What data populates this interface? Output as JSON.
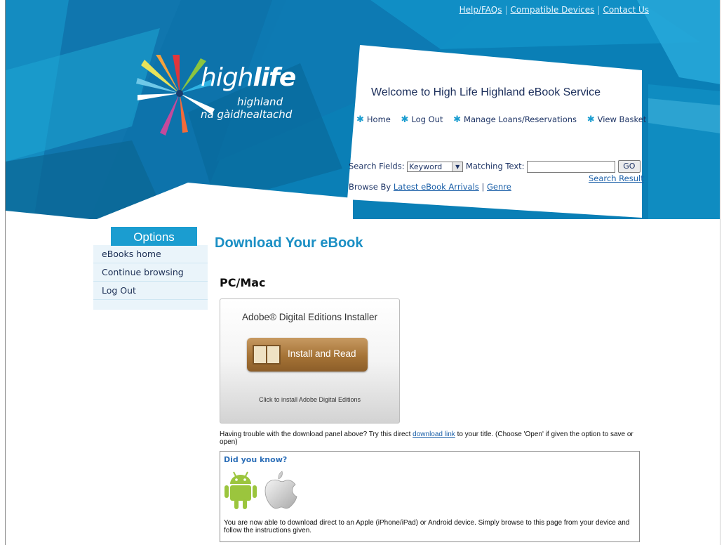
{
  "util_nav": [
    "Help/FAQs",
    "Compatible Devices",
    "Contact Us"
  ],
  "logo": {
    "word_light": "high",
    "word_bold": "life",
    "sub1": "highland",
    "sub2": "na gàidhealtachd"
  },
  "welcome": "Welcome to High Life Highland eBook Service",
  "main_nav": [
    "Home",
    "Log Out",
    "Manage Loans/Reservations",
    "View Basket"
  ],
  "search": {
    "fields_label": "Search Fields:",
    "field_value": "Keyword",
    "matching_label": "Matching Text:",
    "matching_value": "",
    "go_label": "GO",
    "results_link": "Search Result"
  },
  "browse": {
    "label": "Browse By",
    "arrivals": "Latest eBook Arrivals",
    "sep": "|",
    "genre": "Genre"
  },
  "sidebar": {
    "title": "Options",
    "items": [
      "eBooks home",
      "Continue browsing",
      "Log Out"
    ]
  },
  "page_title": "Download Your eBook",
  "pcmac_heading": "PC/Mac",
  "adobe": {
    "title": "Adobe® Digital Editions Installer",
    "button_label": "Install and Read",
    "caption": "Click to install Adobe Digital Editions"
  },
  "trouble": {
    "before": "Having trouble with the download panel above? Try this direct",
    "link": "download link",
    "after": "to your title. (Choose 'Open' if given the option to save or open)"
  },
  "didyouknow": {
    "title": "Did you know?",
    "text": "You are now able to download direct to an Apple (iPhone/iPad) or Android device. Simply browse to this page from your device and follow the instructions given."
  },
  "colors": {
    "accent": "#1b9dd0",
    "header_blue": "#0a7fb6",
    "title_blue": "#1b8fc4",
    "android_green": "#9bc53d"
  }
}
